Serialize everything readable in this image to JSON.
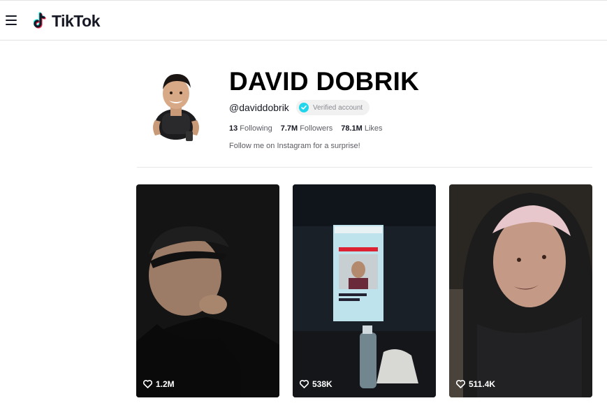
{
  "header": {
    "logo_text": "TikTok",
    "menu_icon": "hamburger-menu-icon"
  },
  "profile": {
    "name": "DAVID DOBRIK",
    "handle": "@daviddobrik",
    "verified_label": "Verified account",
    "stats": {
      "following_count": "13",
      "following_label": "Following",
      "followers_count": "7.7M",
      "followers_label": "Followers",
      "likes_count": "78.1M",
      "likes_label": "Likes"
    },
    "bio": "Follow me on Instagram for a surprise!"
  },
  "videos": [
    {
      "likes": "1.2M"
    },
    {
      "likes": "538K"
    },
    {
      "likes": "511.4K"
    }
  ],
  "colors": {
    "verified_badge": "#20d5ec",
    "logo_cyan": "#25f4ee",
    "logo_pink": "#fe2c55"
  }
}
